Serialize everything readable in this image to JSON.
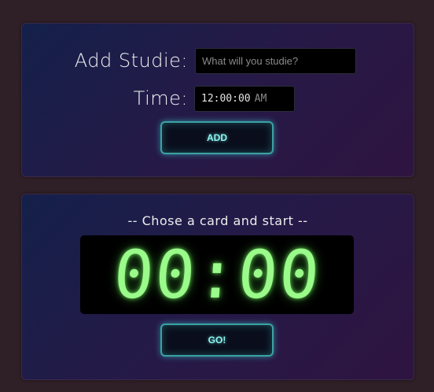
{
  "add_panel": {
    "studie_label": "Add Studie:",
    "studie_placeholder": "What will you studie?",
    "studie_value": "",
    "time_label": "Time:",
    "time_value": "12:00:00",
    "time_ampm": "AM",
    "add_button_label": "ADD"
  },
  "timer_panel": {
    "heading": "-- Chose a card and start --",
    "clock": "00:00",
    "go_button_label": "GO!"
  },
  "colors": {
    "background": "#2f1f26",
    "accent": "#3aa3a3",
    "clock_digits": "#9afa8a"
  }
}
